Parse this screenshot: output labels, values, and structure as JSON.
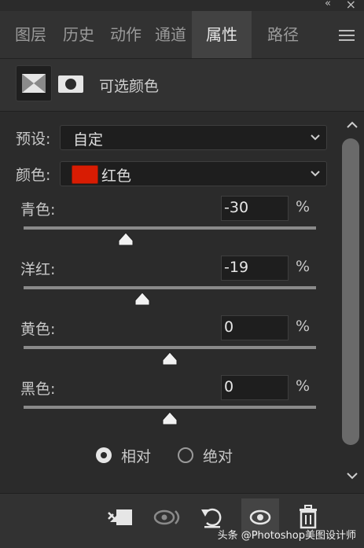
{
  "window": {
    "collapse_glyph": "«",
    "close_glyph": "×"
  },
  "tabs": [
    {
      "label": "图层",
      "active": false
    },
    {
      "label": "历史",
      "active": false
    },
    {
      "label": "动作",
      "active": false
    },
    {
      "label": "通道",
      "active": false
    },
    {
      "label": "属性",
      "active": true
    },
    {
      "label": "路径",
      "active": false
    }
  ],
  "header": {
    "title": "可选颜色"
  },
  "preset": {
    "label": "预设:",
    "value": "自定"
  },
  "colors": {
    "label": "颜色:",
    "value": "红色",
    "swatch": "#d81c03"
  },
  "sliders": [
    {
      "label": "青色:",
      "value": "-30",
      "unit": "%",
      "percent": -30
    },
    {
      "label": "洋红:",
      "value": "-19",
      "unit": "%",
      "percent": -19
    },
    {
      "label": "黄色:",
      "value": "0",
      "unit": "%",
      "percent": 0
    },
    {
      "label": "黑色:",
      "value": "0",
      "unit": "%",
      "percent": 0
    }
  ],
  "method": {
    "relative_label": "相对",
    "absolute_label": "绝对",
    "selected": "relative"
  },
  "watermark": "头条 @Photoshop美图设计师"
}
